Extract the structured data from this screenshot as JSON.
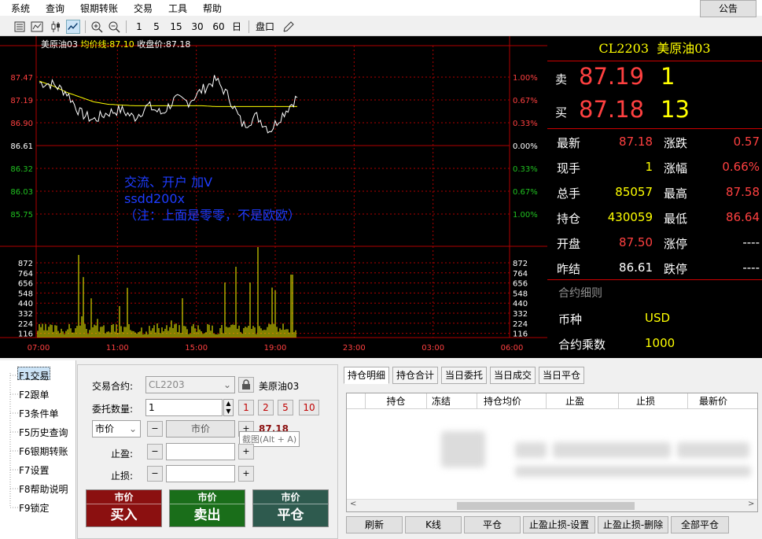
{
  "menu": [
    "系统",
    "查询",
    "银期转账",
    "交易",
    "工具",
    "帮助"
  ],
  "notice_label": "公告",
  "toolbar": {
    "periods": [
      "1",
      "5",
      "15",
      "30",
      "60",
      "日"
    ],
    "pankou": "盘口"
  },
  "chart": {
    "header_name": "美原油03",
    "header_avg": "均价线:87.10",
    "header_close": "收盘价:87.18",
    "price_ticks": [
      "87.47",
      "87.19",
      "86.90",
      "86.61",
      "86.32",
      "86.03",
      "85.75"
    ],
    "pct_ticks": [
      "1.00%",
      "0.67%",
      "0.33%",
      "0.00%",
      "0.33%",
      "0.67%",
      "1.00%"
    ],
    "vol_ticks": [
      "872",
      "764",
      "656",
      "548",
      "440",
      "332",
      "224",
      "116"
    ],
    "time_ticks": [
      "07:00",
      "11:00",
      "15:00",
      "19:00",
      "23:00",
      "03:00",
      "06:00"
    ],
    "overlay": [
      "交流、开户 加V",
      "ssdd200x",
      "（注：上面是零零，不是欧欧）"
    ]
  },
  "chart_data": {
    "type": "line",
    "title": "美原油03",
    "series": [
      {
        "name": "均价线",
        "values": [
          87.42,
          87.36,
          87.28,
          87.22,
          87.16,
          87.13,
          87.12,
          87.11,
          87.11,
          87.11,
          87.11,
          87.11,
          87.11,
          87.1,
          87.1,
          87.1,
          87.1,
          87.1,
          87.1,
          87.1
        ]
      },
      {
        "name": "收盘价",
        "values": [
          87.4,
          87.38,
          87.28,
          87.02,
          86.93,
          87.02,
          87.06,
          86.96,
          87.11,
          87.01,
          87.19,
          87.16,
          87.31,
          87.44,
          87.21,
          86.86,
          86.98,
          86.8,
          87.02,
          87.22
        ]
      }
    ],
    "ylim": [
      85.75,
      87.47
    ]
  },
  "quote": {
    "contract": "CL2203",
    "contract_name": "美原油03",
    "ask_label": "卖",
    "ask_price": "87.19",
    "ask_qty": "1",
    "bid_label": "买",
    "bid_price": "87.18",
    "bid_qty": "13",
    "rows": [
      {
        "l1": "最新",
        "v1": "87.18",
        "c1": "#ff4040",
        "l2": "涨跌",
        "v2": "0.57",
        "c2": "#ff4040"
      },
      {
        "l1": "现手",
        "v1": "1",
        "c1": "#ffff00",
        "l2": "涨幅",
        "v2": "0.66%",
        "c2": "#ff4040"
      },
      {
        "l1": "总手",
        "v1": "85057",
        "c1": "#ffff00",
        "l2": "最高",
        "v2": "87.58",
        "c2": "#ff4040"
      },
      {
        "l1": "持仓",
        "v1": "430059",
        "c1": "#ffff00",
        "l2": "最低",
        "v2": "86.64",
        "c2": "#ff4040"
      },
      {
        "l1": "开盘",
        "v1": "87.50",
        "c1": "#ff4040",
        "l2": "涨停",
        "v2": "----",
        "c2": "#ffffff"
      },
      {
        "l1": "昨结",
        "v1": "86.61",
        "c1": "#ffffff",
        "l2": "跌停",
        "v2": "----",
        "c2": "#ffffff"
      }
    ],
    "detail_title": "合约细则",
    "currency_label": "币种",
    "currency_value": "USD",
    "multiplier_label": "合约乘数",
    "multiplier_value": "1000"
  },
  "nav": [
    "F1交易",
    "F2跟单",
    "F3条件单",
    "F5历史查询",
    "F6银期转账",
    "F7设置",
    "F8帮助说明",
    "F9锁定"
  ],
  "order": {
    "contract_label": "交易合约:",
    "contract_value": "CL2203",
    "contract_name": "美原油03",
    "qty_label": "委托数量:",
    "qty_value": "1",
    "qty_presets": [
      "1",
      "2",
      "5",
      "10"
    ],
    "price_type": "市价",
    "price_field": "市价",
    "price_display": "87.18",
    "tooltip": "截图(Alt + A)",
    "tp_label": "止盈:",
    "sl_label": "止损:",
    "buttons": [
      {
        "top": "市价",
        "main": "买入",
        "color": "#8b1010"
      },
      {
        "top": "市价",
        "main": "卖出",
        "color": "#1a6e1a"
      },
      {
        "top": "市价",
        "main": "平仓",
        "color": "#2e5a4e"
      }
    ]
  },
  "positions": {
    "tabs": [
      "持仓明细",
      "持仓合计",
      "当日委托",
      "当日成交",
      "当日平仓"
    ],
    "columns": [
      "",
      "持仓",
      "冻结",
      "持仓均价",
      "止盈",
      "止损",
      "最新价"
    ],
    "buttons": [
      "刷新",
      "K线",
      "平仓",
      "止盈止损-设置",
      "止盈止损-删除",
      "全部平仓"
    ]
  }
}
